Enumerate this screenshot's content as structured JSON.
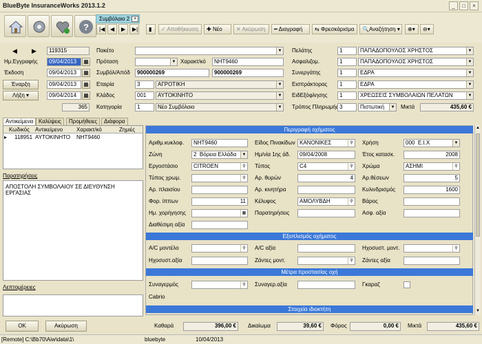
{
  "window": {
    "title": "BlueByte InsuranceWorks 2013.1.2"
  },
  "toolbar": {
    "tab_label": "Συμβόλαιο 2",
    "save_label": "Αποθήκευση",
    "new_label": "Νέο",
    "cancel_label": "Ακύρωση",
    "delete_label": "Διαγραφή",
    "refresh_label": "Φρεσκάρισμα",
    "search_label": "Αναζήτηση"
  },
  "header": {
    "record_no": "119315",
    "reg_date_label": "Ημ.Εγγραφής",
    "reg_date": "09/04/2013",
    "issue_label": "Έκδοση",
    "issue_date": "09/04/2013",
    "start_label": "Έναρξη",
    "start_date": "09/04/2013",
    "end_label": "Λήξη",
    "end_date": "09/04/2014",
    "days": "365",
    "package_label": "Πακέτο",
    "package_value": "",
    "proposal_label": "Πρόταση",
    "proposal_value": "",
    "char_label": "Χαρακτ/κό",
    "char_value": "NHT9460",
    "contract_label": "Συμβόλ/Απόδ",
    "contract_no": "900000269",
    "contract_no2": "900000269",
    "company_label": "Εταιρία",
    "company_code": "3",
    "company_name": "ΑΓΡΟΤΙΚΗ",
    "branch_label": "Κλάδος",
    "branch_code": "001",
    "branch_name": "ΑΥΤΟΚΙΝΗΤΟ",
    "category_label": "Κατηγορία",
    "category_code": "1",
    "category_name": "Νέο Συμβόλαιο",
    "client_label": "Πελάτης",
    "client_code": "1",
    "client_name": "ΠΑΠΑΔΟΠΟΥΛΟΣ ΧΡΗΣΤΟΣ",
    "insured_label": "Ασφαλιζομ.",
    "insured_code": "1",
    "insured_name": "ΠΑΠΑΔΟΠΟΥΛΟΣ ΧΡΗΣΤΟΣ",
    "partner_label": "Συνεργάτης",
    "partner_code": "1",
    "partner_name": "ΕΔΡΑ",
    "collector_label": "Εισπράκτορας",
    "collector_code": "1",
    "collector_name": "ΕΔΡΑ",
    "collection_label": "ΕιδΕξόφλησης",
    "collection_code": "1",
    "collection_name": "ΧΡΕΩΣΕΙΣ ΣΥΜΒΟΛΑΙΩΝ ΠΕΛΑΤΩΝ",
    "payment_label": "Τρόπος Πληρωμής",
    "payment_code": "3",
    "payment_name": "Πιστωτική",
    "gross_label": "Μικτά",
    "gross_value": "435,60 €"
  },
  "left_tabs": [
    "Αντικείμενα",
    "Καλύψεις",
    "Προμήθειες",
    "Διάφορα"
  ],
  "objects_table": {
    "columns": [
      "Κωδικός",
      "Αντικείμενο",
      "Χαρακτ/κό",
      "Ζημιές"
    ],
    "rows": [
      {
        "code": "118951",
        "object": "ΑΥΤΟΚΙΝΗΤΟ",
        "char": "NHT9460",
        "damages": ""
      }
    ]
  },
  "notes": {
    "label": "Παρατηρήσεις",
    "text": "ΑΠΟΣΤΟΛΗ ΣΥΜΒΟΛΑΙΟΥ ΣΕ ΔΙΕΥΘΥΝΣΗ ΕΡΓΑΣΙΑΣ"
  },
  "details_label": "Λεπτομέρειες",
  "vehicle_desc": {
    "band": "Περιγραφή οχήματος",
    "plate_label": "Αριθμ.κυκλοφ.",
    "plate": "NHT9460",
    "plate_type_label": "Είδος Πινακίδων",
    "plate_type": "ΚΑΝΟΝΙΚΕΣ",
    "use_label": "Χρήση",
    "use_code": "000",
    "use_name": "Ε.Ι.Χ",
    "zone_label": "Ζώνη",
    "zone_code": "2",
    "zone_name": "Βόρεια Ελλάδα",
    "first_date_label": "Ημ/νία 1ης άδ.",
    "first_date": "09/04/2008",
    "year_label": "Έτος κατασκ.",
    "year": "2008",
    "factory_label": "Εργοστάσιο",
    "factory": "CITROEN",
    "type_label": "Τύπος",
    "type": "C4",
    "color_label": "Χρώμα",
    "color": "ΑΣΗΜΙ",
    "chrom_type_label": "Τύπος χρωμ.",
    "chrom_type": "",
    "doors_label": "Αρ. θυρών",
    "doors": "4",
    "seats_label": "Αρ.θέσεων",
    "seats": "5",
    "chassis_label": "Αρ. πλαισίου",
    "chassis": "",
    "engine_label": "Αρ. κινητήρα",
    "engine": "",
    "cc_label": "Κυλινδρισμός",
    "cc": "1600",
    "hp_label": "Φορ. ίππων",
    "hp": "11",
    "body_label": "Κέλυφος",
    "body": "ΑΜΟΛΥΒΔΗ",
    "weight_label": "Βάρος",
    "weight": "",
    "usage_date_label": "Ημ. χορήγησης",
    "usage_date": "",
    "remarks_label": "Παρατηρήσεις",
    "remarks": "",
    "ins_value_label": "Ασφ. αξία",
    "ins_value": "",
    "other_value_label": "Διαθέσιμη αξία",
    "other_value": ""
  },
  "equipment": {
    "band": "Εξοπλισμός οχήματος",
    "ac_model_label": "A/C μοντέλο",
    "ac_value_label": "A/C αξία",
    "sound_model_label": "Ηχοσυστ. μοντ.",
    "sound_value_label": "Ηχοσυστ.αξία",
    "wheels_model_label": "Ζάντες μοντ.",
    "wheels_value_label": "Ζάντες αξία"
  },
  "protection": {
    "band": "Μέτρα προστασίας οχή",
    "alarm_label": "Συναγερμός",
    "alarm_value_label": "Συναγερ.αξία",
    "gps_label": "Γκαραζ",
    "cabrio_label": "Cabrio"
  },
  "owner_band": "Στοιχεία ιδιοκτήτη",
  "footer": {
    "ok_label": "OK",
    "cancel_label": "Ακύρωση",
    "net_label": "Καθαρά",
    "net_value": "396,00 €",
    "fees_label": "Δικαίωμα",
    "fees_value": "39,60 €",
    "tax_label": "Φόρος",
    "tax_value": "0,00 €",
    "gross_label": "Μικτά",
    "gross_value": "435,60 €"
  },
  "status": {
    "remote": "[Remote] C:\\Bb70\\Aiw\\data\\1\\",
    "user": "bluebyte",
    "date": "10/04/2013"
  }
}
